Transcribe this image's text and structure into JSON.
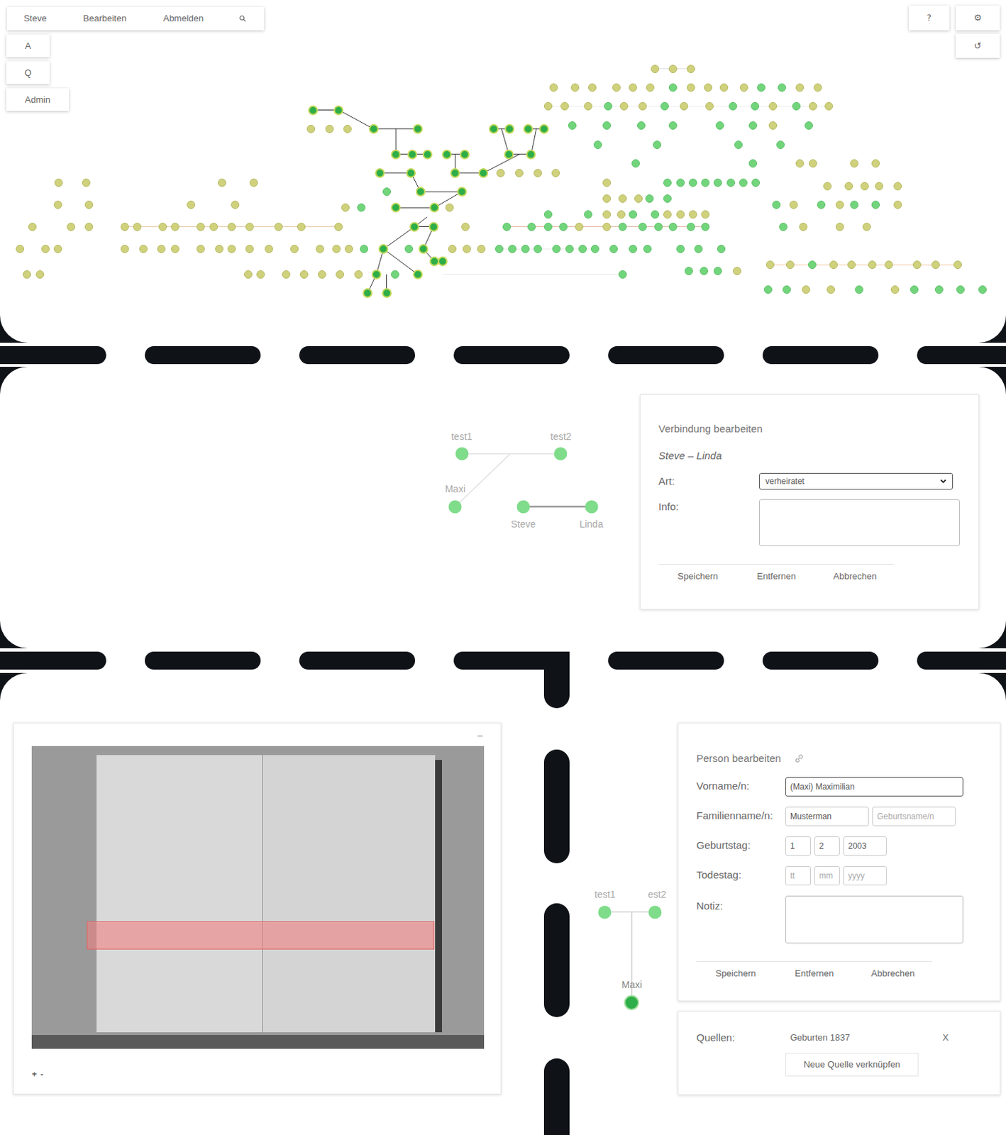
{
  "toolbar": {
    "items": [
      {
        "label": "Steve"
      },
      {
        "label": "Bearbeiten"
      },
      {
        "label": "Abmelden"
      }
    ]
  },
  "side_buttons": [
    {
      "label": "A"
    },
    {
      "label": "Q"
    },
    {
      "label": "Admin"
    }
  ],
  "corner_buttons": [
    {
      "label": "?"
    },
    {
      "label": "⚙"
    },
    {
      "label": "↺"
    }
  ],
  "tree": {
    "rows": [
      {
        "kinds": [
          "olive",
          "olive",
          "olive"
        ]
      },
      {
        "kinds": [
          "olive",
          "olive",
          "olive",
          "olive",
          "olive",
          "olive",
          "green",
          "olive",
          "olive",
          "olive",
          "olive",
          "green",
          "green",
          "olive",
          "olive"
        ]
      },
      {
        "kinds": [
          "olive",
          "olive",
          "olive",
          "green",
          "olive",
          "olive",
          "green",
          "olive",
          "olive",
          "green",
          "green",
          "olive",
          "green",
          "olive",
          "olive"
        ]
      },
      {
        "kinds": [
          "focus",
          "focus"
        ]
      },
      {
        "kinds": [
          "olive",
          "olive",
          "olive",
          "focus",
          "focus",
          "focus",
          "focus",
          "focus",
          "focus"
        ]
      },
      {
        "kinds": [
          "green",
          "green",
          "green",
          "green",
          "green",
          "green",
          "olive",
          "green"
        ]
      },
      {
        "kinds": [
          "green",
          "green",
          "green",
          "green"
        ]
      },
      {
        "kinds": [
          "focus",
          "focus",
          "focus",
          "focus",
          "focus",
          "focus",
          "focus"
        ]
      },
      {
        "kinds": [
          "green",
          "green",
          "olive",
          "olive",
          "olive",
          "olive"
        ]
      },
      {
        "kinds": [
          "focus",
          "focus",
          "focus",
          "focus",
          "olive",
          "olive",
          "olive",
          "olive"
        ]
      },
      {
        "kinds": [
          "olive",
          "olive",
          "olive",
          "olive",
          "olive",
          "green",
          "green",
          "green",
          "green",
          "green",
          "green",
          "green",
          "green"
        ]
      },
      {
        "kinds": [
          "olive",
          "olive",
          "olive",
          "olive",
          "olive"
        ]
      },
      {
        "kinds": [
          "green",
          "focus",
          "focus"
        ]
      },
      {
        "kinds": [
          "olive",
          "olive",
          "olive",
          "green",
          "green"
        ]
      },
      {
        "kinds": [
          "olive",
          "olive",
          "olive",
          "olive",
          "green",
          "olive",
          "green",
          "olive",
          "green",
          "green",
          "olive"
        ]
      },
      {
        "kinds": [
          "olive",
          "green",
          "focus",
          "focus",
          "olive"
        ]
      },
      {
        "kinds": [
          "green",
          "green",
          "olive",
          "olive",
          "green",
          "green",
          "olive",
          "olive",
          "olive",
          "olive"
        ]
      },
      {
        "kinds": [
          "olive",
          "olive",
          "olive",
          "olive",
          "olive",
          "olive",
          "olive",
          "olive",
          "olive",
          "olive",
          "olive",
          "olive",
          "olive",
          "olive",
          "focus",
          "focus",
          "olive",
          "green",
          "green",
          "green",
          "green",
          "olive",
          "olive",
          "green",
          "green",
          "green",
          "green",
          "green",
          "green",
          "green",
          "olive",
          "olive",
          "olive"
        ]
      },
      {
        "kinds": [
          "olive",
          "olive",
          "olive",
          "olive",
          "olive",
          "olive",
          "olive",
          "olive",
          "olive",
          "olive",
          "olive",
          "olive",
          "olive",
          "olive",
          "olive",
          "olive",
          "green",
          "focus",
          "green",
          "focus",
          "olive",
          "olive",
          "olive",
          "green",
          "green",
          "green",
          "green",
          "green",
          "green",
          "green",
          "green",
          "green",
          "green",
          "green",
          "green",
          "green",
          "green"
        ]
      },
      {
        "kinds": [
          "focus",
          "focus"
        ]
      },
      {
        "kinds": [
          "olive",
          "olive",
          "green",
          "olive",
          "olive",
          "olive",
          "olive",
          "olive",
          "olive",
          "olive"
        ]
      },
      {
        "kinds": [
          "green",
          "green",
          "green",
          "olive"
        ]
      },
      {
        "kinds": [
          "olive",
          "olive",
          "olive",
          "olive",
          "olive",
          "olive",
          "olive",
          "olive",
          "olive",
          "focus",
          "green",
          "focus",
          "green"
        ]
      },
      {
        "kinds": [
          "green",
          "green",
          "olive",
          "olive",
          "green",
          "olive",
          "green",
          "green",
          "green",
          "green"
        ]
      },
      {
        "kinds": [
          "focus",
          "focus"
        ]
      }
    ]
  },
  "relation_graph": {
    "nodes": [
      {
        "label": "test1"
      },
      {
        "label": "test2"
      },
      {
        "label": "Maxi"
      },
      {
        "label": "Steve"
      },
      {
        "label": "Linda"
      }
    ]
  },
  "connection_form": {
    "title": "Verbindung bearbeiten",
    "pair": "Steve – Linda",
    "fields": [
      {
        "label": "Art:",
        "kind": "select",
        "value": "verheiratet"
      },
      {
        "label": "Info:",
        "kind": "textarea"
      }
    ],
    "buttons": [
      "Speichern",
      "Entfernen",
      "Abbrechen"
    ]
  },
  "viewer": {
    "minimize": "–",
    "zoom_in": "+",
    "zoom_out": "-"
  },
  "person_graph": {
    "nodes": [
      {
        "label": "test1",
        "selected": false
      },
      {
        "label": "est2",
        "selected": false
      },
      {
        "label": "Maxi",
        "selected": true
      }
    ]
  },
  "person_form": {
    "title": "Person bearbeiten",
    "fields": [
      {
        "label": "Vorname/n:",
        "kind": "inputs",
        "inputs": [
          {
            "value": "(Maxi) Maximilian",
            "focused": true
          }
        ]
      },
      {
        "label": "Familienname/n:",
        "kind": "inputs",
        "inputs": [
          {
            "value": "Musterman",
            "focused": false
          },
          {
            "placeholder": "Geburtsname/n",
            "focused": false
          }
        ]
      },
      {
        "label": "Geburtstag:",
        "kind": "inputs",
        "inputs": [
          {
            "value": "1",
            "focused": false
          },
          {
            "value": "2",
            "focused": false
          },
          {
            "value": "2003",
            "focused": false
          }
        ]
      },
      {
        "label": "Todestag:",
        "kind": "inputs",
        "inputs": [
          {
            "placeholder": "tt",
            "focused": false
          },
          {
            "placeholder": "mm",
            "focused": false
          },
          {
            "placeholder": "yyyy",
            "focused": false
          }
        ]
      },
      {
        "label": "Notiz:",
        "kind": "textarea"
      }
    ],
    "buttons": [
      "Speichern",
      "Entfernen",
      "Abbrechen"
    ]
  },
  "sources": {
    "label": "Quellen:",
    "items": [
      {
        "name": "Geburten 1837",
        "remove": "X"
      }
    ],
    "link_button": "Neue Quelle verknüpfen"
  }
}
